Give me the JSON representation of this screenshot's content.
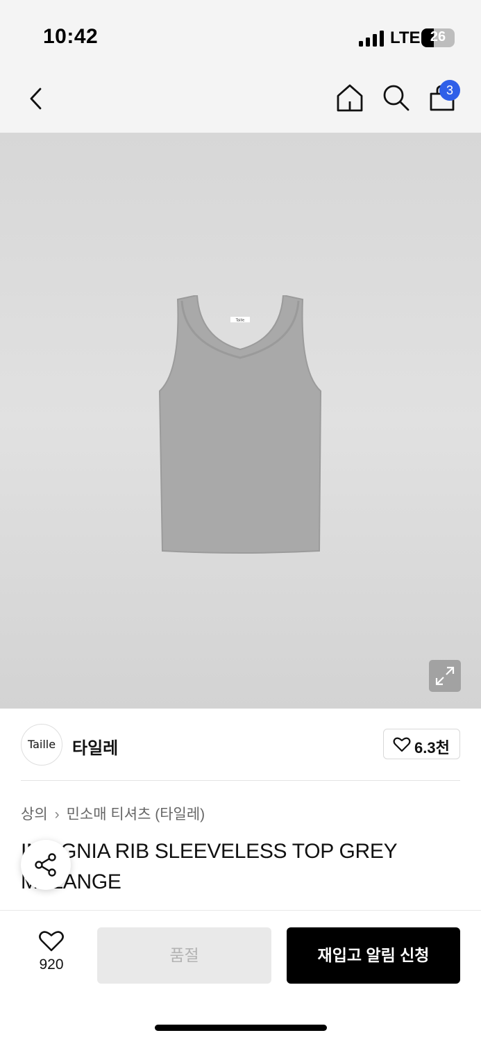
{
  "status_bar": {
    "time": "10:42",
    "network": "LTE",
    "battery": "26"
  },
  "nav": {
    "cart_count": "3"
  },
  "product_image": {
    "label_text": "Taille"
  },
  "brand": {
    "logo_text": "Taille",
    "name": "타일레",
    "likes": "6.3천"
  },
  "breadcrumb": {
    "category": "상의",
    "subcategory": "민소매 티셔츠 (타일레)"
  },
  "product": {
    "title": "INSIGNIA RIB SLEEVELESS TOP GREY MELANGE"
  },
  "bottom_bar": {
    "wish_count": "920",
    "soldout_label": "품절",
    "restock_label": "재입고 알림 신청"
  },
  "colors": {
    "accent_badge": "#2f5fe8",
    "primary_button": "#000000",
    "disabled_button": "#e9e9e9"
  }
}
